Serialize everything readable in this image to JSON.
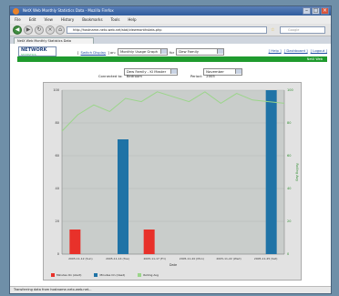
{
  "window": {
    "title": "NetX Web Monthly Statistics Data - Mozilla Firefox"
  },
  "menu": [
    "File",
    "Edit",
    "View",
    "History",
    "Bookmarks",
    "Tools",
    "Help"
  ],
  "url": "http://hostname-netx-web.net/stat/viewmonthstats.php",
  "search_placeholder": "Google",
  "tab": {
    "label": "NetX Web Monthly Statistics Data"
  },
  "logo": {
    "text": "NETWORK",
    "sub": "STATISTICS"
  },
  "controls": {
    "prefix": "[",
    "link": "Switch Display",
    "sep": "] on:",
    "graph_select": "Monthly Usage Graph",
    "for": "for",
    "family_select": "Dew Family"
  },
  "right_links": [
    "[ Help ]",
    "[ Dashboard ]",
    "[ Logout ]"
  ],
  "green_bar": "NetX Web",
  "filters": {
    "connection_label": "Connected to:",
    "connection_select": "Dew Family - KI Master Bedroom",
    "period_label": "Period:",
    "period_select": "November 2005"
  },
  "chart_data": {
    "type": "bar",
    "categories": [
      "2005-11-12 (Sun)",
      "2005-11-14 (Tue)",
      "2005-11-17 (Fri)",
      "2005-11-20 (Mon)",
      "2005-11-22 (Wed)",
      "2005-11-25 (Sat)"
    ],
    "series": [
      {
        "name": "Minutes On (Alert)",
        "color": "#e8312a",
        "values": [
          15,
          0,
          15,
          0,
          0,
          0
        ]
      },
      {
        "name": "Minutes On (Used)",
        "color": "#1f73a6",
        "values": [
          0,
          70,
          0,
          0,
          0,
          100
        ]
      },
      {
        "name": "Rolling Avg",
        "color": "#9bd58a",
        "values": []
      }
    ],
    "line_y": [
      75,
      85,
      91,
      87,
      95,
      93,
      99,
      96,
      93,
      99,
      92,
      98,
      94,
      93,
      92
    ],
    "ylim": [
      0,
      100
    ],
    "y_ticks": [
      0,
      20,
      40,
      60,
      80,
      100
    ],
    "x_label": "Date",
    "y2_label": "Rolling Avg",
    "grid": true
  },
  "status": "Transferring data from hostname-netx-web.net..."
}
